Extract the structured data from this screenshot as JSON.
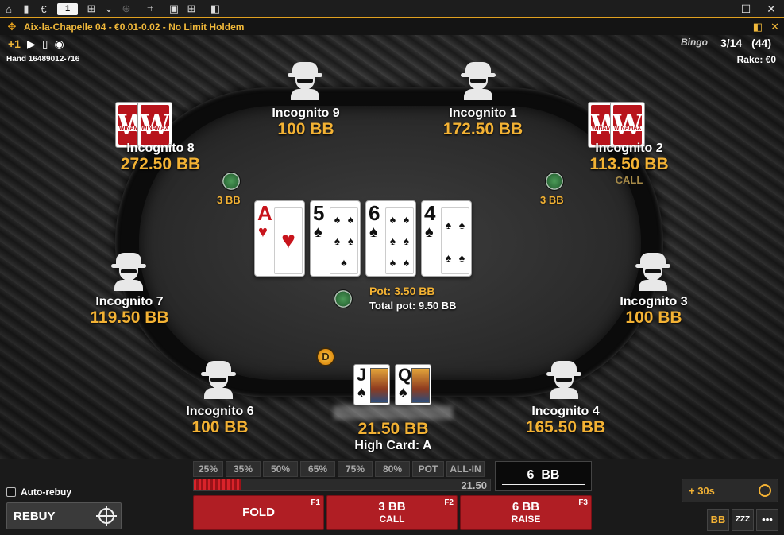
{
  "system_bar": {
    "table_number": "1",
    "icons": [
      "home-icon",
      "stats-icon",
      "euro-icon",
      "grid-icon",
      "chevron-down-icon",
      "zoom-icon",
      "crop-icon",
      "restore-icon",
      "add-table-icon",
      "sidebar-icon",
      "minimize-icon",
      "maximize-icon",
      "close-icon"
    ]
  },
  "title_bar": {
    "title": "Aix-la-Chapelle 04  -  €0.01-0.02  -  No Limit Holdem"
  },
  "sub_bar": {
    "plus_one": "+1",
    "hand_info": "Hand 16489012-716",
    "bingo_label": "Bingo",
    "position": "3/14",
    "players": "(44)",
    "rake": "Rake: €0"
  },
  "seats": [
    {
      "name": "Incognito 9",
      "stack": "100 BB"
    },
    {
      "name": "Incognito 1",
      "stack": "172.50 BB"
    },
    {
      "name": "Incognito 8",
      "stack": "272.50 BB"
    },
    {
      "name": "Incognito 2",
      "stack": "113.50 BB",
      "action": "CALL"
    },
    {
      "name": "Incognito 7",
      "stack": "119.50 BB"
    },
    {
      "name": "Incognito 3",
      "stack": "100 BB"
    },
    {
      "name": "Incognito 6",
      "stack": "100 BB"
    },
    {
      "name": "Incognito 4",
      "stack": "165.50 BB"
    }
  ],
  "card_back_brand": "WINAMAX",
  "card_back_letter": "W",
  "bets": {
    "left": "3 BB",
    "right": "3 BB"
  },
  "board": [
    {
      "rank": "A",
      "suit": "♥",
      "color": "#c8141c"
    },
    {
      "rank": "5",
      "suit": "♠",
      "color": "#111111"
    },
    {
      "rank": "6",
      "suit": "♠",
      "color": "#111111"
    },
    {
      "rank": "4",
      "suit": "♠",
      "color": "#111111"
    }
  ],
  "pot": "Pot: 3.50 BB",
  "total_pot": "Total pot: 9.50 BB",
  "dealer_button": "D",
  "hero": {
    "cards": [
      {
        "rank": "J",
        "suit": "♠"
      },
      {
        "rank": "Q",
        "suit": "♠"
      }
    ],
    "stack": "21.50 BB",
    "hand": "High Card: A"
  },
  "controls": {
    "presets": [
      "25%",
      "35%",
      "50%",
      "65%",
      "75%",
      "80%",
      "POT",
      "ALL-IN"
    ],
    "slider_max": "21.50",
    "bet_input_value": "6  BB",
    "fold": {
      "label": "FOLD",
      "key": "F1"
    },
    "call": {
      "amount": "3 BB",
      "label": "CALL",
      "key": "F2"
    },
    "raise": {
      "amount": "6 BB",
      "label": "RAISE",
      "key": "F3"
    },
    "auto_rebuy": "Auto-rebuy",
    "rebuy": "REBUY",
    "time_bank": "+ 30s",
    "bb_toggle": "BB",
    "sleep_label": "ZZZ",
    "more_label": "•••"
  },
  "colors": {
    "accent": "#f3b234",
    "action_red": "#b01e24"
  }
}
